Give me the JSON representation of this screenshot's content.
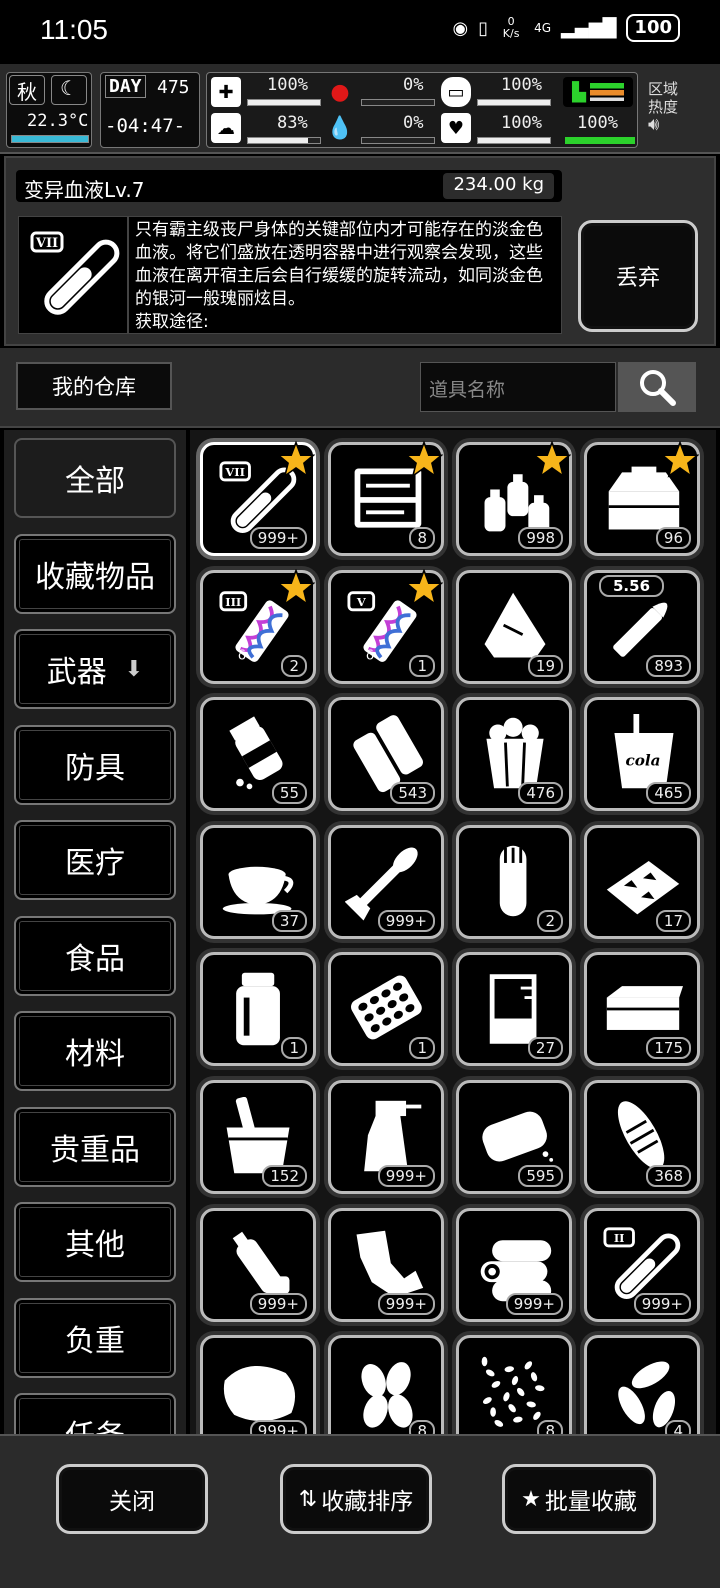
{
  "status_bar": {
    "time": "11:05",
    "net_speed": "0 K/s",
    "network": "4G",
    "battery": "100"
  },
  "hud": {
    "season": "秋",
    "temperature": "22.3°C",
    "day_label": "DAY",
    "day_number": "475",
    "clock": "-04:47-",
    "stats": {
      "medical": "100%",
      "head": "83%",
      "stomach": "0%",
      "blood": "0%",
      "pill": "100%",
      "heart": "100%",
      "stamina": "100%"
    },
    "stat_levels": {
      "medical": 1.0,
      "head": 0.83,
      "stomach": 0.0,
      "blood": 0.0,
      "pill": 1.0,
      "heart": 1.0,
      "stamina": 1.0
    },
    "zone_label_1": "区域",
    "zone_label_2": "热度"
  },
  "detail": {
    "name": "变异血液Lv.7",
    "weight": "234.00 kg",
    "description": "只有霸主级丧尸身体的关键部位内才可能存在的淡金色血液。将它们盛放在透明容器中进行观察会发现，这些血液在离开宿主后会自行缓缓的旋转流动，如同淡金色的银河一般瑰丽炫目。",
    "source_label": "获取途径:",
    "discard_label": "丢弃"
  },
  "search": {
    "my_storage": "我的仓库",
    "placeholder": "道具名称"
  },
  "categories": [
    "全部",
    "收藏物品",
    "武器",
    "防具",
    "医疗",
    "食品",
    "材料",
    "贵重品",
    "其他",
    "负重",
    "任务"
  ],
  "items": [
    {
      "icon": "blood-vial-icon",
      "roman": "VII",
      "count": "999+",
      "favorite": true
    },
    {
      "icon": "toolbox-icon",
      "count": "8",
      "favorite": true
    },
    {
      "icon": "bottles-icon",
      "count": "998",
      "favorite": true
    },
    {
      "icon": "tool-chest-icon",
      "count": "96",
      "favorite": true
    },
    {
      "icon": "dna-syringe-icon",
      "roman": "III",
      "count": "2",
      "favorite": true
    },
    {
      "icon": "dna-syringe-icon",
      "roman": "V",
      "count": "1",
      "favorite": true
    },
    {
      "icon": "rice-bag-icon",
      "count": "19",
      "favorite": false
    },
    {
      "icon": "bullet-icon",
      "ammo": "5.56",
      "count": "893",
      "favorite": false
    },
    {
      "icon": "pill-bottle-icon",
      "count": "55",
      "favorite": false
    },
    {
      "icon": "paper-rolls-icon",
      "count": "543",
      "favorite": false
    },
    {
      "icon": "popcorn-icon",
      "count": "476",
      "favorite": false
    },
    {
      "icon": "cola-cup-icon",
      "cup_text": "cola",
      "count": "465",
      "favorite": false
    },
    {
      "icon": "coffee-cup-icon",
      "count": "37",
      "favorite": false
    },
    {
      "icon": "rocket-icon",
      "count": "999+",
      "favorite": false
    },
    {
      "icon": "test-tube-icon",
      "count": "2",
      "favorite": false
    },
    {
      "icon": "cookies-tray-icon",
      "count": "17",
      "favorite": false
    },
    {
      "icon": "jar-icon",
      "count": "1",
      "favorite": false
    },
    {
      "icon": "pill-blister-icon",
      "count": "1",
      "favorite": false
    },
    {
      "icon": "beaker-icon",
      "count": "27",
      "favorite": false
    },
    {
      "icon": "box-icon",
      "count": "175",
      "favorite": false
    },
    {
      "icon": "bucket-icon",
      "count": "152",
      "favorite": false
    },
    {
      "icon": "spray-bottle-icon",
      "count": "999+",
      "favorite": false
    },
    {
      "icon": "bread-icon",
      "count": "595",
      "favorite": false
    },
    {
      "icon": "corn-icon",
      "count": "368",
      "favorite": false
    },
    {
      "icon": "plastic-bottle-icon",
      "count": "999+",
      "favorite": false
    },
    {
      "icon": "scrap-metal-icon",
      "count": "999+",
      "favorite": false
    },
    {
      "icon": "logs-icon",
      "count": "999+",
      "favorite": false
    },
    {
      "icon": "blood-vial-icon",
      "roman": "II",
      "count": "999+",
      "favorite": false
    },
    {
      "icon": "meat-icon",
      "count": "999+",
      "favorite": false
    },
    {
      "icon": "almonds-icon",
      "count": "8",
      "favorite": false
    },
    {
      "icon": "seeds-icon",
      "count": "8",
      "favorite": false
    },
    {
      "icon": "sunflower-seeds-icon",
      "count": "4",
      "favorite": false
    }
  ],
  "bottom": {
    "close": "关闭",
    "sort": "收藏排序",
    "batch": "批量收藏"
  }
}
